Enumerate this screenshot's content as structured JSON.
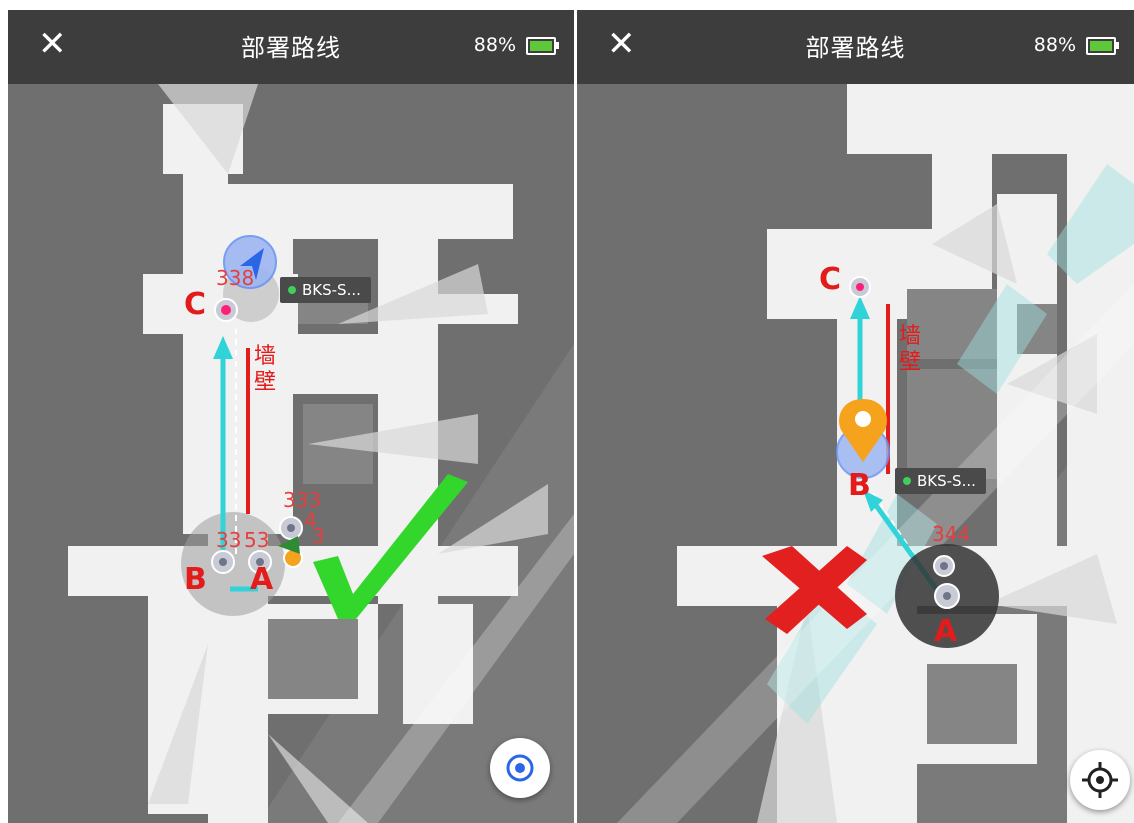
{
  "left_screen": {
    "close_glyph": "✕",
    "title": "部署路线",
    "battery": "88%",
    "point_labels": {
      "a": "A",
      "b": "B",
      "c": "C"
    },
    "wall_label": "墙壁",
    "map_numbers": {
      "top": "338",
      "mid1": "333",
      "mid2": "4",
      "low1": "33",
      "low2": "53",
      "low3": "3"
    },
    "robot_tag": "BKS-S...",
    "locate_icon": "target-icon",
    "verdict_icon": "check-mark-icon"
  },
  "right_screen": {
    "close_glyph": "✕",
    "title": "部署路线",
    "battery": "88%",
    "point_labels": {
      "a": "A",
      "b": "B",
      "c": "C"
    },
    "wall_label": "墙壁",
    "map_numbers": {
      "a": "344"
    },
    "robot_tag": "BKS-S...",
    "locate_icon": "crosshair-icon",
    "verdict_icon": "cross-mark-icon"
  },
  "colors": {
    "header_bg": "#3d3d3d",
    "map_bg": "#7a7a7a",
    "floor": "#f2f2f2",
    "route_arrow": "#2fd3d8",
    "wall_line": "#e51c1c",
    "label_red": "#e41b1b",
    "check_green": "#33d62b",
    "cross_red": "#e32020",
    "watermark_teal": "#9fe0e0",
    "battery_green": "#5dc93a",
    "marker_orange": "#f5a31d",
    "robot_blue": "#5a8dee"
  }
}
